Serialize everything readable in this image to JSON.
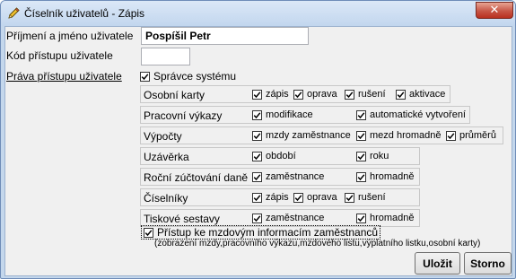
{
  "window": {
    "title": "Číselník uživatelů - Zápis",
    "icon": "pencil-icon",
    "close_glyph": "✕"
  },
  "fields": {
    "name_label": "Příjmení a jméno uživatele",
    "name_value": "Pospíšil Petr",
    "code_label": "Kód přístupu uživatele",
    "code_value": "",
    "rights_label": "Práva přístupu uživatele"
  },
  "admin": {
    "label": "Správce systému",
    "checked": true
  },
  "groups": [
    {
      "label": "Osobní karty",
      "items": [
        {
          "label": "zápis",
          "checked": true
        },
        {
          "label": "oprava",
          "checked": true
        },
        {
          "label": "rušení",
          "checked": true
        },
        {
          "label": "aktivace",
          "checked": true
        }
      ]
    },
    {
      "label": "Pracovní výkazy",
      "items": [
        {
          "label": "modifikace",
          "checked": true
        },
        {
          "label": "automatické vytvoření",
          "checked": true
        }
      ]
    },
    {
      "label": "Výpočty",
      "items": [
        {
          "label": "mzdy zaměstnance",
          "checked": true
        },
        {
          "label": "mezd hromadně",
          "checked": true
        },
        {
          "label": "průměrů",
          "checked": true
        }
      ]
    },
    {
      "label": "Uzávěrka",
      "items": [
        {
          "label": "období",
          "checked": true
        },
        {
          "label": "roku",
          "checked": true
        }
      ]
    },
    {
      "label": "Roční zúčtování daně",
      "items": [
        {
          "label": "zaměstnance",
          "checked": true
        },
        {
          "label": "hromadně",
          "checked": true
        }
      ]
    },
    {
      "label": "Číselníky",
      "items": [
        {
          "label": "zápis",
          "checked": true
        },
        {
          "label": "oprava",
          "checked": true
        },
        {
          "label": "rušení",
          "checked": true
        }
      ]
    },
    {
      "label": "Tiskové sestavy",
      "items": [
        {
          "label": "zaměstnance",
          "checked": true
        },
        {
          "label": "hromadně",
          "checked": true
        }
      ]
    }
  ],
  "wage_access": {
    "label": "Přístup ke mzdovým informacím zaměstnanců",
    "note": "(zobrazení mzdy,pracovního výkazu,mzdového listu,výplatního listku,osobní karty)",
    "checked": true
  },
  "buttons": {
    "save": "Uložit",
    "cancel": "Storno"
  },
  "colors": {
    "title_bg": "#c4d7ec",
    "close_button": "#c75646",
    "client_bg": "#f0f0f0"
  }
}
